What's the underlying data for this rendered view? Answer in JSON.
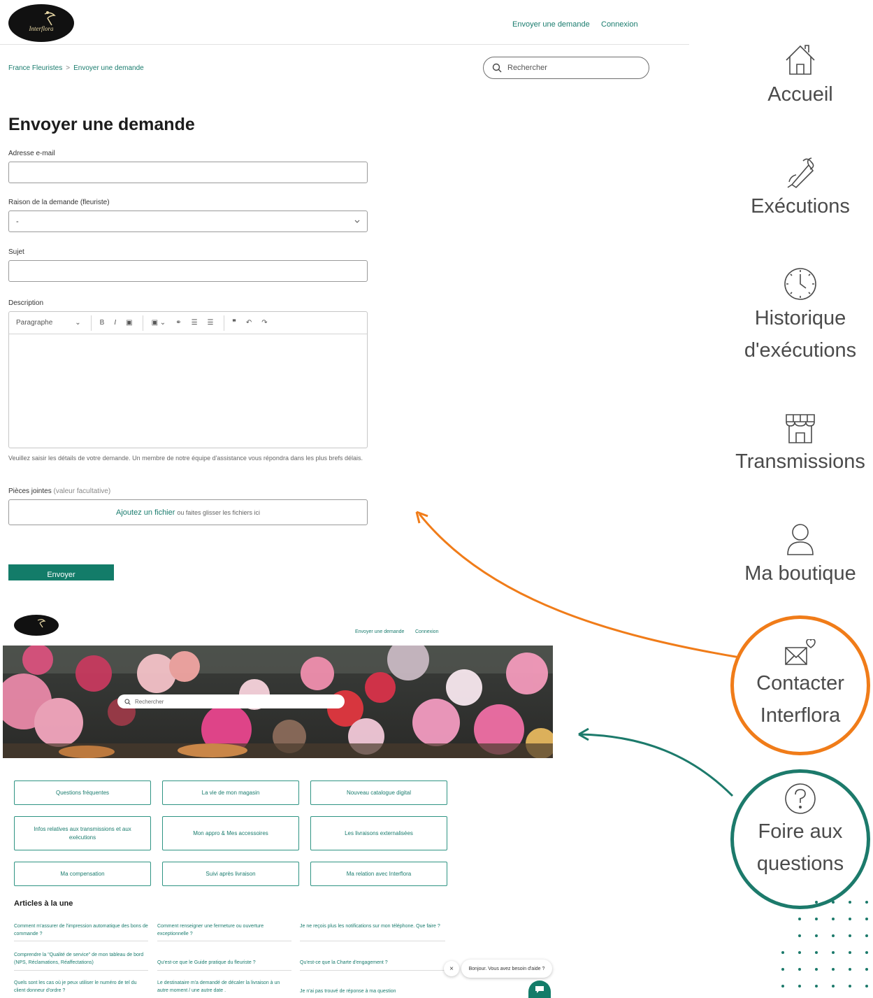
{
  "top_screenshot": {
    "logo": {
      "text": "Interflora"
    },
    "header_links": {
      "send_request": "Envoyer une demande",
      "login": "Connexion"
    },
    "breadcrumb": {
      "root": "France Fleuristes",
      "separator": ">",
      "current": "Envoyer une demande"
    },
    "search": {
      "placeholder": "Rechercher"
    },
    "title": "Envoyer une demande",
    "form": {
      "email_label": "Adresse e-mail",
      "email_value": "",
      "reason_label": "Raison de la demande (fleuriste)",
      "reason_value": "-",
      "subject_label": "Sujet",
      "subject_value": "",
      "description_label": "Description",
      "editor_toolbar": {
        "paragraph": "Paragraphe",
        "bold": "B",
        "italic": "I"
      },
      "description_help": "Veuillez saisir les détails de votre demande. Un membre de notre équipe d'assistance vous répondra dans les plus brefs délais.",
      "attachments_label": "Pièces jointes",
      "attachments_optional": "(valeur facultative)",
      "attach_link": "Ajoutez un fichier",
      "attach_rest": "ou faites glisser les fichiers ici",
      "submit": "Envoyer"
    }
  },
  "sidebar": {
    "items": [
      {
        "label": "Accueil",
        "icon": "home-icon"
      },
      {
        "label": "Exécutions",
        "icon": "bouquet-icon"
      },
      {
        "label_line1": "Historique",
        "label_line2": "d'exécutions",
        "icon": "clock-icon"
      },
      {
        "label": "Transmissions",
        "icon": "shop-icon"
      },
      {
        "label": "Ma boutique",
        "icon": "user-icon"
      },
      {
        "label_line1": "Contacter",
        "label_line2": "Interflora",
        "icon": "mail-heart-icon",
        "highlight": "#f07c19"
      },
      {
        "label_line1": "Foire aux",
        "label_line2": "questions",
        "icon": "question-icon",
        "highlight": "#1c7a6b"
      }
    ]
  },
  "bottom_screenshot": {
    "header_links": {
      "send_request": "Envoyer une demande",
      "login": "Connexion"
    },
    "search": {
      "placeholder": "Rechercher"
    },
    "categories": [
      "Questions fréquentes",
      "La vie de mon magasin",
      "Nouveau catalogue digital",
      "Infos relatives aux transmissions et aux exécutions",
      "Mon appro & Mes accessoires",
      "Les livraisons externalisées",
      "Ma compensation",
      "Suivi après livraison",
      "Ma relation avec Interflora"
    ],
    "articles_title": "Articles à la une",
    "articles": [
      "Comment m'assurer de l'impression automatique des bons de commande ?",
      "Comment renseigner une fermeture ou ouverture exceptionnelle ?",
      "Je ne reçois plus les notifications sur mon téléphone. Que faire ?",
      "Comprendre la \"Qualité de service\" de mon tableau de bord (NPS, Réclamations, Réaffectations)",
      "Qu'est-ce que le Guide pratique du fleuriste ?",
      "Qu'est-ce que la Charte d'engagement ?",
      "Quels sont les cas où je peux utiliser le numéro de tel du client donneur d'ordre ?",
      "Le destinataire m'a demandé de décaler la livraison à un autre moment / une autre date .",
      "Je n'ai pas trouvé de réponse à ma question"
    ],
    "chat": {
      "close": "×",
      "message": "Bonjour. Vous avez besoin d'aide ?"
    }
  },
  "colors": {
    "brand_teal": "#137c69",
    "orange": "#f07c19",
    "teal_ring": "#1c7a6b"
  }
}
